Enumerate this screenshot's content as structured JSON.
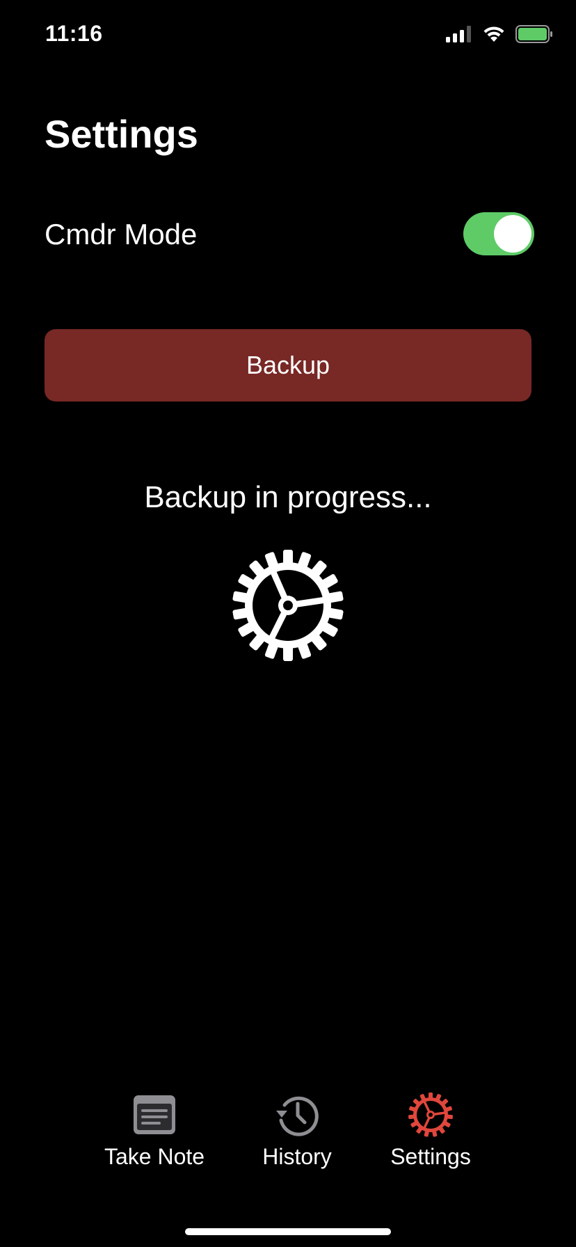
{
  "status_bar": {
    "time": "11:16",
    "icons": [
      "signal-icon",
      "wifi-icon",
      "battery-icon"
    ]
  },
  "page": {
    "title": "Settings"
  },
  "cmdr_mode": {
    "label": "Cmdr Mode",
    "enabled": true
  },
  "backup": {
    "button_label": "Backup",
    "status_text": "Backup in progress...",
    "status_icon": "gear-icon"
  },
  "tab_bar": {
    "tabs": [
      {
        "label": "Take Note",
        "icon": "note-icon",
        "active": false
      },
      {
        "label": "History",
        "icon": "history-icon",
        "active": false
      },
      {
        "label": "Settings",
        "icon": "gear-icon",
        "active": true
      }
    ]
  },
  "colors": {
    "background": "#000000",
    "toggle_on": "#5ecb67",
    "backup_button": "#782825",
    "active_tab": "#e0473c",
    "inactive_icon": "#8e8e93"
  }
}
